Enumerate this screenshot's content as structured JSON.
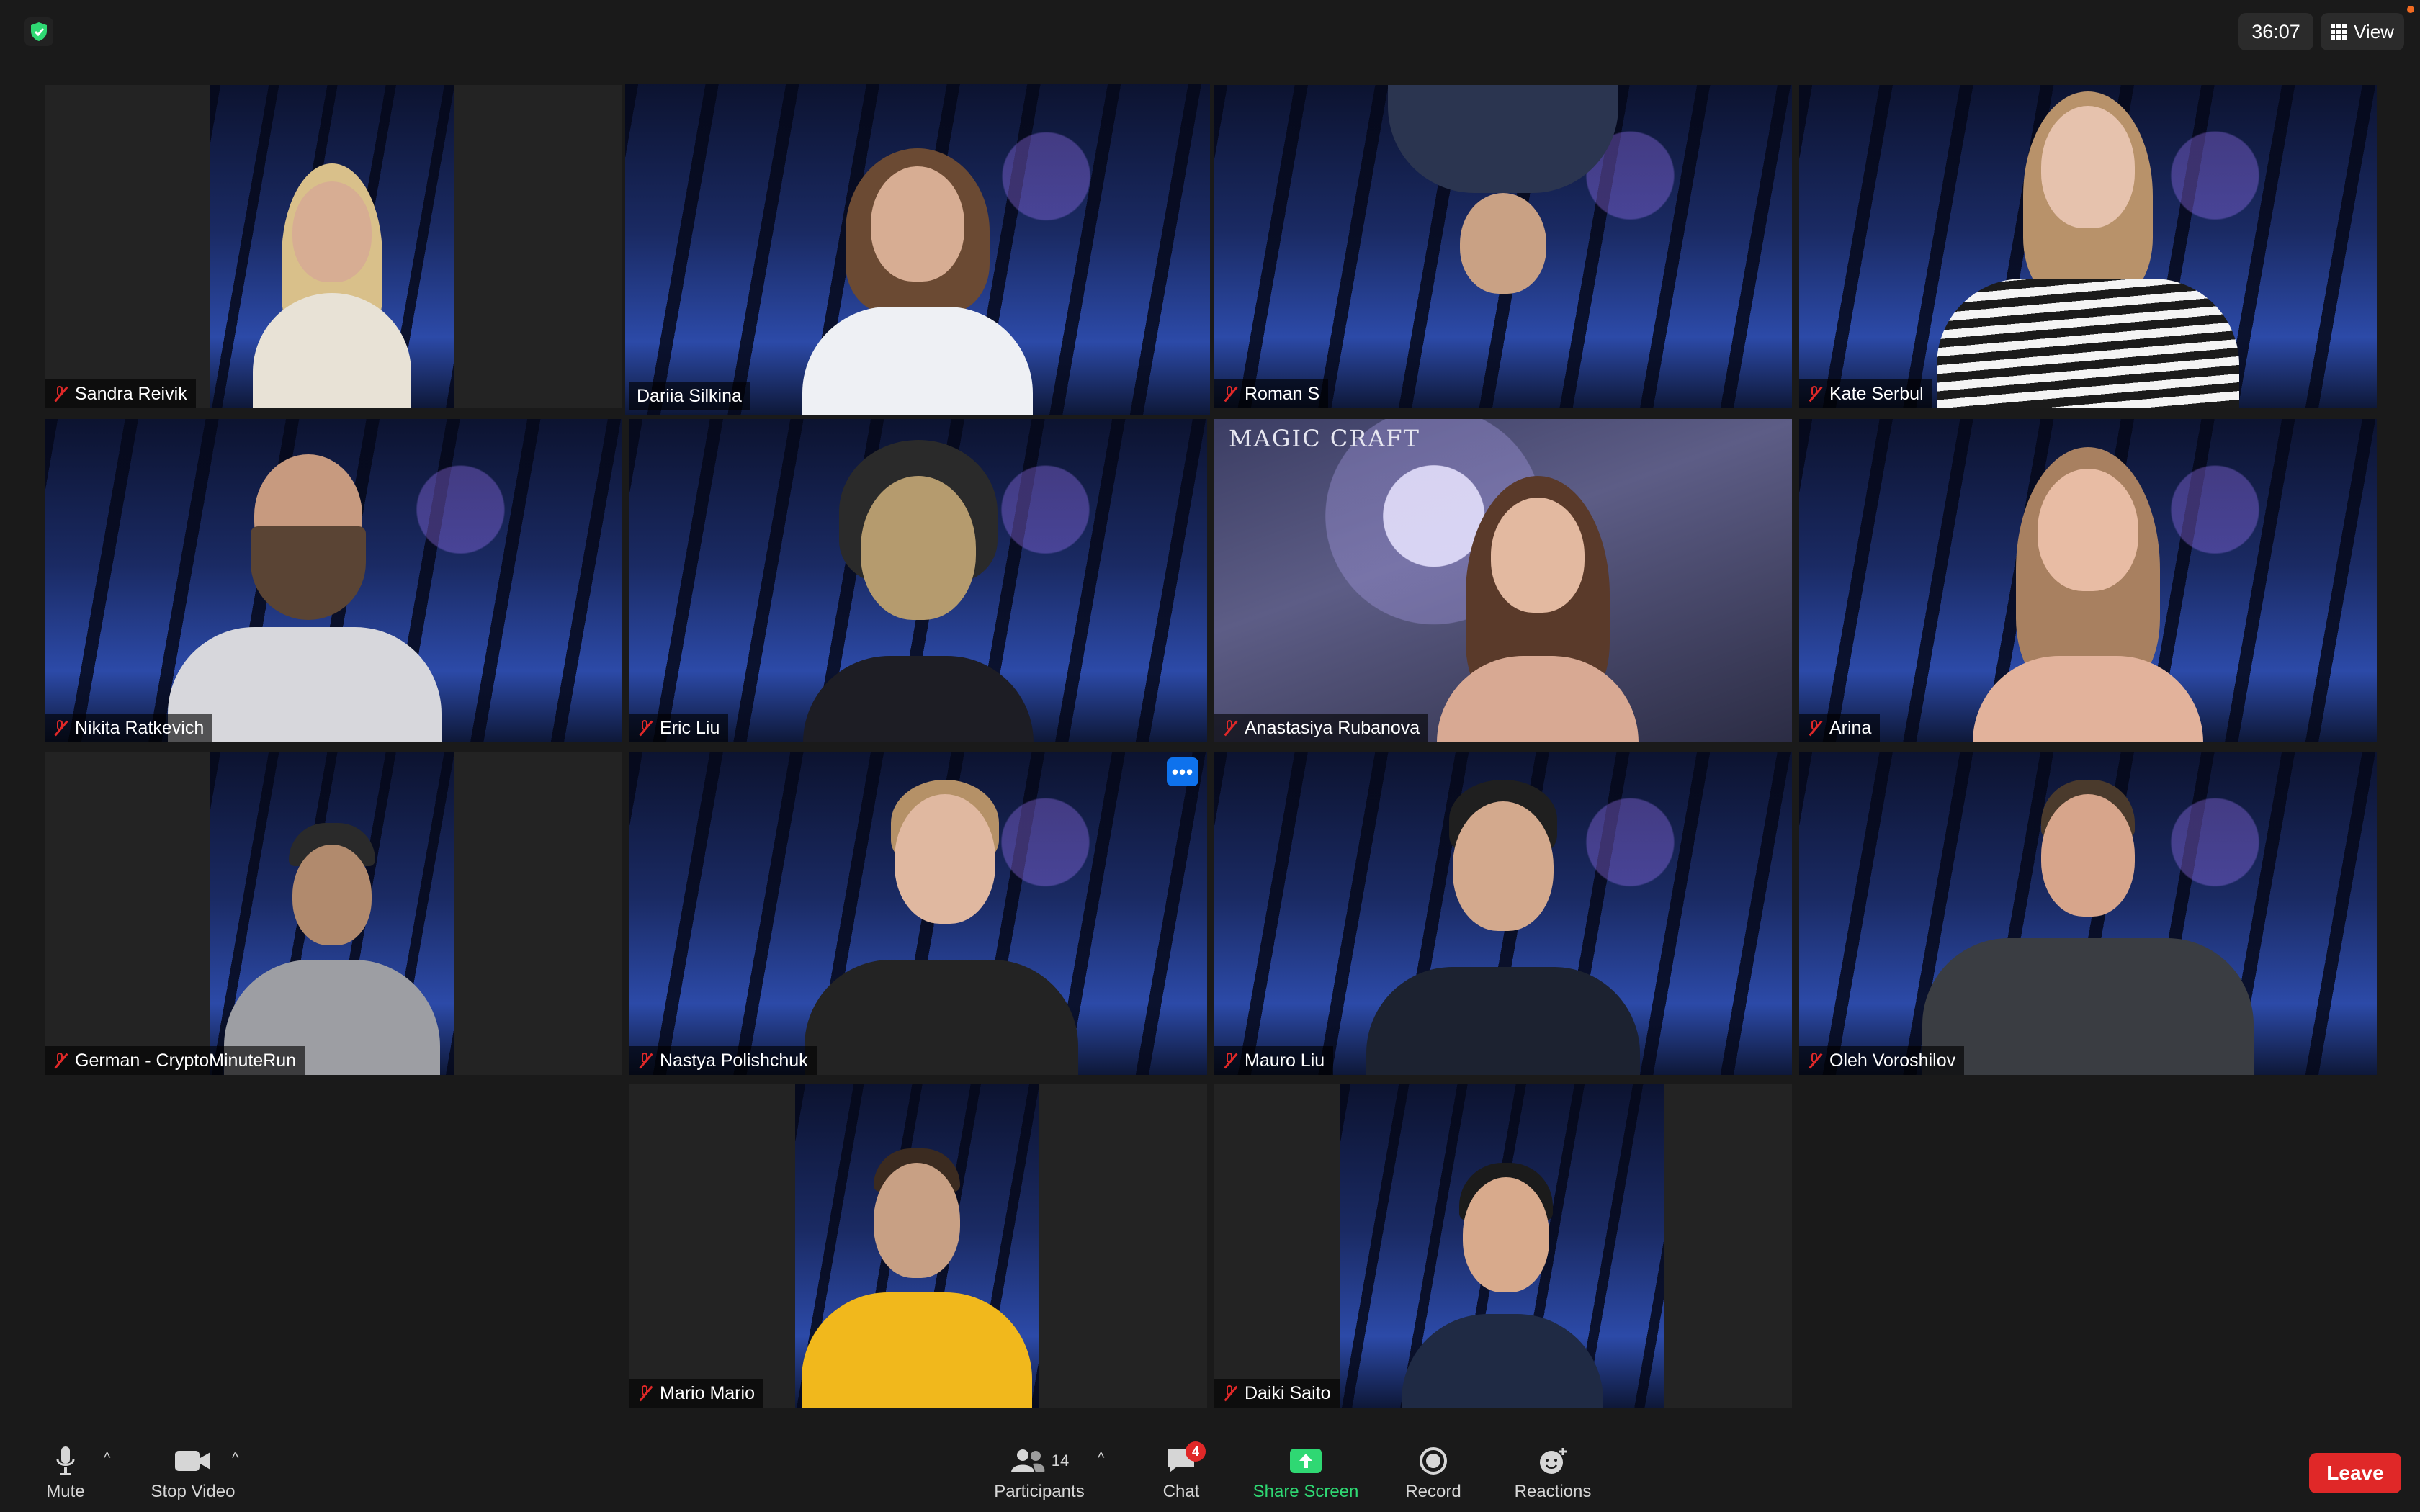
{
  "meeting": {
    "timer": "36:07",
    "view_label": "View",
    "security_icon": "shield-check-icon",
    "active_speaker_color": "#e6ee8e"
  },
  "participants": [
    {
      "name": "Sandra Reivik",
      "muted": true
    },
    {
      "name": "Dariia Silkina",
      "muted": false,
      "active": true
    },
    {
      "name": "Roman S",
      "muted": true
    },
    {
      "name": "Kate Serbul",
      "muted": true
    },
    {
      "name": "Nikita Ratkevich",
      "muted": true
    },
    {
      "name": "Eric Liu",
      "muted": true
    },
    {
      "name": "Anastasiya Rubanova",
      "muted": true,
      "background_text": "MAGIC CRAFT"
    },
    {
      "name": "Arina",
      "muted": true
    },
    {
      "name": "German - CryptoMinuteRun",
      "muted": true
    },
    {
      "name": "Nastya Polishchuk",
      "muted": true,
      "more_label": "•••"
    },
    {
      "name": "Mauro Liu",
      "muted": true
    },
    {
      "name": "Oleh Voroshilov",
      "muted": true
    },
    {
      "name": "Mario Mario",
      "muted": true
    },
    {
      "name": "Daiki Saito",
      "muted": true
    }
  ],
  "toolbar": {
    "mute_label": "Mute",
    "stop_video_label": "Stop Video",
    "participants_label": "Participants",
    "participants_count": "14",
    "chat_label": "Chat",
    "chat_badge": "4",
    "share_screen_label": "Share Screen",
    "record_label": "Record",
    "reactions_label": "Reactions",
    "leave_label": "Leave",
    "leave_color": "#e02828",
    "share_color": "#2fd873"
  }
}
